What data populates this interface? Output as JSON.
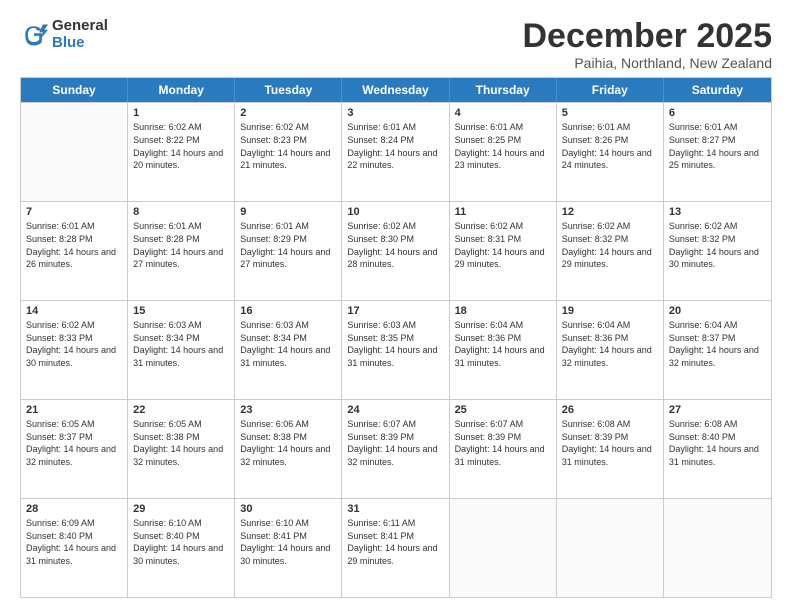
{
  "logo": {
    "general": "General",
    "blue": "Blue"
  },
  "title": {
    "month": "December 2025",
    "location": "Paihia, Northland, New Zealand"
  },
  "calendar": {
    "headers": [
      "Sunday",
      "Monday",
      "Tuesday",
      "Wednesday",
      "Thursday",
      "Friday",
      "Saturday"
    ],
    "weeks": [
      [
        {
          "day": "",
          "sunrise": "",
          "sunset": "",
          "daylight": "",
          "empty": true
        },
        {
          "day": "1",
          "sunrise": "Sunrise: 6:02 AM",
          "sunset": "Sunset: 8:22 PM",
          "daylight": "Daylight: 14 hours and 20 minutes."
        },
        {
          "day": "2",
          "sunrise": "Sunrise: 6:02 AM",
          "sunset": "Sunset: 8:23 PM",
          "daylight": "Daylight: 14 hours and 21 minutes."
        },
        {
          "day": "3",
          "sunrise": "Sunrise: 6:01 AM",
          "sunset": "Sunset: 8:24 PM",
          "daylight": "Daylight: 14 hours and 22 minutes."
        },
        {
          "day": "4",
          "sunrise": "Sunrise: 6:01 AM",
          "sunset": "Sunset: 8:25 PM",
          "daylight": "Daylight: 14 hours and 23 minutes."
        },
        {
          "day": "5",
          "sunrise": "Sunrise: 6:01 AM",
          "sunset": "Sunset: 8:26 PM",
          "daylight": "Daylight: 14 hours and 24 minutes."
        },
        {
          "day": "6",
          "sunrise": "Sunrise: 6:01 AM",
          "sunset": "Sunset: 8:27 PM",
          "daylight": "Daylight: 14 hours and 25 minutes."
        }
      ],
      [
        {
          "day": "7",
          "sunrise": "Sunrise: 6:01 AM",
          "sunset": "Sunset: 8:28 PM",
          "daylight": "Daylight: 14 hours and 26 minutes."
        },
        {
          "day": "8",
          "sunrise": "Sunrise: 6:01 AM",
          "sunset": "Sunset: 8:28 PM",
          "daylight": "Daylight: 14 hours and 27 minutes."
        },
        {
          "day": "9",
          "sunrise": "Sunrise: 6:01 AM",
          "sunset": "Sunset: 8:29 PM",
          "daylight": "Daylight: 14 hours and 27 minutes."
        },
        {
          "day": "10",
          "sunrise": "Sunrise: 6:02 AM",
          "sunset": "Sunset: 8:30 PM",
          "daylight": "Daylight: 14 hours and 28 minutes."
        },
        {
          "day": "11",
          "sunrise": "Sunrise: 6:02 AM",
          "sunset": "Sunset: 8:31 PM",
          "daylight": "Daylight: 14 hours and 29 minutes."
        },
        {
          "day": "12",
          "sunrise": "Sunrise: 6:02 AM",
          "sunset": "Sunset: 8:32 PM",
          "daylight": "Daylight: 14 hours and 29 minutes."
        },
        {
          "day": "13",
          "sunrise": "Sunrise: 6:02 AM",
          "sunset": "Sunset: 8:32 PM",
          "daylight": "Daylight: 14 hours and 30 minutes."
        }
      ],
      [
        {
          "day": "14",
          "sunrise": "Sunrise: 6:02 AM",
          "sunset": "Sunset: 8:33 PM",
          "daylight": "Daylight: 14 hours and 30 minutes."
        },
        {
          "day": "15",
          "sunrise": "Sunrise: 6:03 AM",
          "sunset": "Sunset: 8:34 PM",
          "daylight": "Daylight: 14 hours and 31 minutes."
        },
        {
          "day": "16",
          "sunrise": "Sunrise: 6:03 AM",
          "sunset": "Sunset: 8:34 PM",
          "daylight": "Daylight: 14 hours and 31 minutes."
        },
        {
          "day": "17",
          "sunrise": "Sunrise: 6:03 AM",
          "sunset": "Sunset: 8:35 PM",
          "daylight": "Daylight: 14 hours and 31 minutes."
        },
        {
          "day": "18",
          "sunrise": "Sunrise: 6:04 AM",
          "sunset": "Sunset: 8:36 PM",
          "daylight": "Daylight: 14 hours and 31 minutes."
        },
        {
          "day": "19",
          "sunrise": "Sunrise: 6:04 AM",
          "sunset": "Sunset: 8:36 PM",
          "daylight": "Daylight: 14 hours and 32 minutes."
        },
        {
          "day": "20",
          "sunrise": "Sunrise: 6:04 AM",
          "sunset": "Sunset: 8:37 PM",
          "daylight": "Daylight: 14 hours and 32 minutes."
        }
      ],
      [
        {
          "day": "21",
          "sunrise": "Sunrise: 6:05 AM",
          "sunset": "Sunset: 8:37 PM",
          "daylight": "Daylight: 14 hours and 32 minutes."
        },
        {
          "day": "22",
          "sunrise": "Sunrise: 6:05 AM",
          "sunset": "Sunset: 8:38 PM",
          "daylight": "Daylight: 14 hours and 32 minutes."
        },
        {
          "day": "23",
          "sunrise": "Sunrise: 6:06 AM",
          "sunset": "Sunset: 8:38 PM",
          "daylight": "Daylight: 14 hours and 32 minutes."
        },
        {
          "day": "24",
          "sunrise": "Sunrise: 6:07 AM",
          "sunset": "Sunset: 8:39 PM",
          "daylight": "Daylight: 14 hours and 32 minutes."
        },
        {
          "day": "25",
          "sunrise": "Sunrise: 6:07 AM",
          "sunset": "Sunset: 8:39 PM",
          "daylight": "Daylight: 14 hours and 31 minutes."
        },
        {
          "day": "26",
          "sunrise": "Sunrise: 6:08 AM",
          "sunset": "Sunset: 8:39 PM",
          "daylight": "Daylight: 14 hours and 31 minutes."
        },
        {
          "day": "27",
          "sunrise": "Sunrise: 6:08 AM",
          "sunset": "Sunset: 8:40 PM",
          "daylight": "Daylight: 14 hours and 31 minutes."
        }
      ],
      [
        {
          "day": "28",
          "sunrise": "Sunrise: 6:09 AM",
          "sunset": "Sunset: 8:40 PM",
          "daylight": "Daylight: 14 hours and 31 minutes."
        },
        {
          "day": "29",
          "sunrise": "Sunrise: 6:10 AM",
          "sunset": "Sunset: 8:40 PM",
          "daylight": "Daylight: 14 hours and 30 minutes."
        },
        {
          "day": "30",
          "sunrise": "Sunrise: 6:10 AM",
          "sunset": "Sunset: 8:41 PM",
          "daylight": "Daylight: 14 hours and 30 minutes."
        },
        {
          "day": "31",
          "sunrise": "Sunrise: 6:11 AM",
          "sunset": "Sunset: 8:41 PM",
          "daylight": "Daylight: 14 hours and 29 minutes."
        },
        {
          "day": "",
          "sunrise": "",
          "sunset": "",
          "daylight": "",
          "empty": true
        },
        {
          "day": "",
          "sunrise": "",
          "sunset": "",
          "daylight": "",
          "empty": true
        },
        {
          "day": "",
          "sunrise": "",
          "sunset": "",
          "daylight": "",
          "empty": true
        }
      ]
    ]
  }
}
